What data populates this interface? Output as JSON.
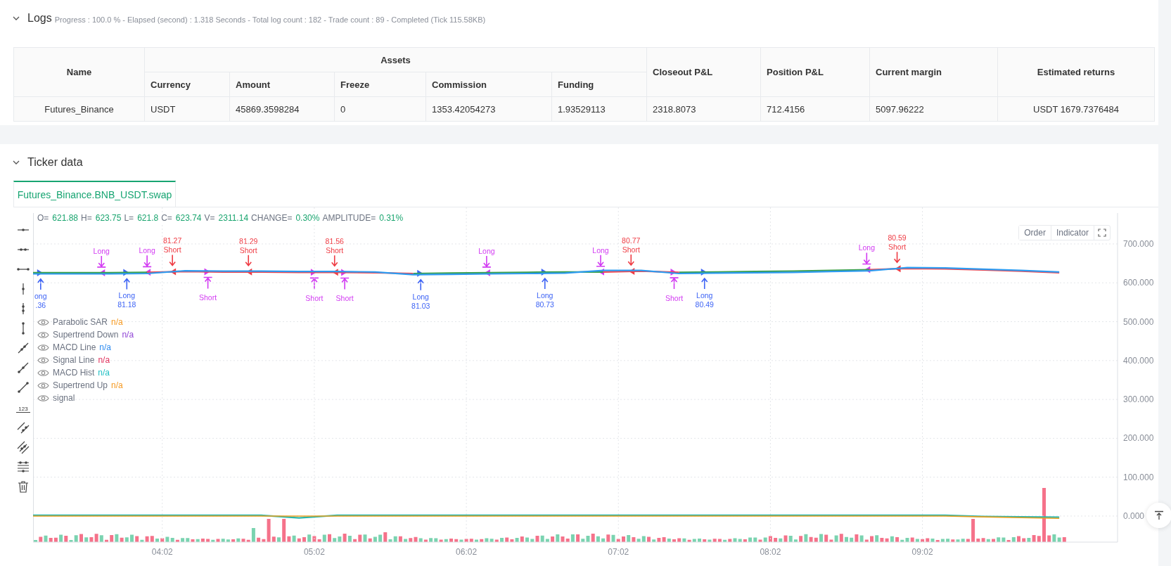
{
  "logs": {
    "title": "Logs",
    "expanded": true,
    "summary": "Progress : 100.0 % - Elapsed (second) : 1.318  Seconds - Total log count : 182 - Trade count : 89 - Completed (Tick 115.58KB)",
    "table": {
      "header_rows": [
        [
          {
            "text": "Name",
            "rowspan": 2
          },
          {
            "text": "Assets",
            "colspan": 5
          },
          {
            "text": "Closeout P&L",
            "rowspan": 2
          },
          {
            "text": "Position P&L",
            "rowspan": 2
          },
          {
            "text": "Current margin",
            "rowspan": 2
          },
          {
            "text": "Estimated returns",
            "rowspan": 2
          }
        ],
        [
          {
            "text": "Currency"
          },
          {
            "text": "Amount"
          },
          {
            "text": "Freeze"
          },
          {
            "text": "Commission"
          },
          {
            "text": "Funding"
          }
        ]
      ],
      "rows": [
        [
          "Futures_Binance",
          "USDT",
          "45869.3598284",
          "0",
          "1353.42054273",
          "1.93529113",
          "2318.8073",
          "712.4156",
          "5097.96222",
          "USDT 1679.7376484"
        ]
      ]
    }
  },
  "ticker": {
    "title": "Ticker data",
    "expanded": true,
    "tabs": [
      {
        "label": "Futures_Binance.BNB_USDT.swap",
        "selected": true
      }
    ],
    "chart": {
      "drawing_tools": [
        {
          "kind": "h-dot"
        },
        {
          "kind": "h-two-dots"
        },
        {
          "kind": "h-segment"
        },
        {
          "kind": "v-dot"
        },
        {
          "kind": "v-two-dots"
        },
        {
          "kind": "v-segment"
        },
        {
          "kind": "ray-two-dots"
        },
        {
          "kind": "ray-dot"
        },
        {
          "kind": "segment"
        },
        {
          "kind": "price-note",
          "text": "123"
        },
        {
          "kind": "parallel"
        },
        {
          "kind": "channel"
        },
        {
          "kind": "fib"
        },
        {
          "kind": "trash"
        }
      ],
      "ohlc": [
        {
          "label": "O=",
          "value": "621.88"
        },
        {
          "label": "H=",
          "value": "623.75"
        },
        {
          "label": "L=",
          "value": "621.8"
        },
        {
          "label": "C=",
          "value": "623.74"
        },
        {
          "label": "V=",
          "value": "2311.14"
        },
        {
          "label": "CHANGE=",
          "value": "0.30%"
        },
        {
          "label": "AMPLITUDE=",
          "value": "0.31%"
        }
      ],
      "legend": [
        {
          "name": "Parabolic SAR",
          "value": "n/a",
          "color": "#f59a23"
        },
        {
          "name": "Supertrend Down",
          "value": "n/a",
          "color": "#9247d6"
        },
        {
          "name": "MACD Line",
          "value": "n/a",
          "color": "#2f8cf0"
        },
        {
          "name": "Signal Line",
          "value": "n/a",
          "color": "#e0335e"
        },
        {
          "name": "MACD Hist",
          "value": "n/a",
          "color": "#1fbfc4"
        },
        {
          "name": "Supertrend Up",
          "value": "n/a",
          "color": "#f59a23"
        },
        {
          "name": "signal"
        }
      ],
      "buttons": [
        "Order",
        "Indicator"
      ],
      "signals": [
        {
          "kind": "long-entry",
          "label": "ong",
          "value": ".36"
        },
        {
          "kind": "long-exit",
          "label": "Long"
        },
        {
          "kind": "long-entry",
          "label": "Long",
          "value": "81.18"
        },
        {
          "kind": "long-exit",
          "label": "Long"
        },
        {
          "kind": "short-entry",
          "label": "Short",
          "value": "81.27"
        },
        {
          "kind": "short-exit",
          "label": "Short"
        },
        {
          "kind": "short-entry",
          "label": "Short",
          "value": "81.29"
        },
        {
          "kind": "short-exit",
          "label": "Short"
        },
        {
          "kind": "short-entry",
          "label": "Short",
          "value": "81.56"
        },
        {
          "kind": "short-exit",
          "label": "Short"
        },
        {
          "kind": "long-entry",
          "label": "Long",
          "value": "81.03"
        },
        {
          "kind": "long-exit",
          "label": "Long"
        },
        {
          "kind": "long-entry",
          "label": "Long",
          "value": "80.73"
        },
        {
          "kind": "long-exit",
          "label": "Long"
        },
        {
          "kind": "short-entry",
          "label": "Short",
          "value": "80.77"
        },
        {
          "kind": "short-exit",
          "label": "Short"
        },
        {
          "kind": "long-entry",
          "label": "Long",
          "value": "80.49"
        },
        {
          "kind": "long-exit",
          "label": "Long"
        },
        {
          "kind": "short-entry",
          "label": "Short",
          "value": "80.59"
        }
      ],
      "chart_data": {
        "type": "line",
        "grid": true,
        "x": [
          191,
          206,
          221,
          236,
          251,
          266,
          281,
          296,
          311,
          326,
          341,
          356,
          371,
          386,
          401,
          416,
          431,
          446,
          461,
          476,
          491,
          506,
          521,
          536,
          551,
          566,
          581,
          596
        ],
        "series": [
          {
            "color": "#3aa04a",
            "values": [
              626,
              626,
              626,
              627,
              null,
              null,
              null,
              null,
              null,
              null,
              624,
              625,
              626,
              627,
              628,
              628,
              null,
              627,
              628,
              629,
              630,
              632,
              634,
              null,
              null,
              null,
              null,
              null
            ]
          },
          {
            "color": "#f0464e",
            "values": [
              null,
              null,
              null,
              627,
              629,
              628,
              628,
              627,
              627,
              626,
              624,
              null,
              null,
              null,
              null,
              628,
              630,
              627,
              null,
              null,
              null,
              null,
              634,
              637,
              636,
              633,
              630,
              626
            ]
          },
          {
            "color": "#2e9bf0",
            "values": [
              623,
              623,
              623,
              624,
              631,
              630,
              630,
              629,
              629,
              628,
              621,
              622,
              623,
              624,
              625,
              632,
              632,
              624,
              625,
              626,
              627,
              629,
              631,
              639,
              638,
              635,
              632,
              628
            ]
          },
          {
            "color": "#2bb5a8",
            "values": [
              2,
              2,
              2,
              2,
              2,
              2,
              2,
              -5,
              2,
              2,
              2,
              2,
              2,
              2,
              2,
              2,
              2,
              2,
              2,
              2,
              2,
              2,
              2,
              2,
              2,
              -1,
              -2,
              -3
            ]
          },
          {
            "color": "#e8a020",
            "values": [
              0,
              0,
              0,
              0,
              0,
              0,
              0,
              0,
              0,
              0,
              0,
              0,
              0,
              0,
              0,
              0,
              0,
              0,
              0,
              0,
              0,
              0,
              0,
              0,
              0,
              -2,
              -4,
              -6
            ]
          }
        ],
        "xlim": [
          191,
          619
        ],
        "ylim": [
          -67,
          794
        ],
        "xticks": [
          {
            "value": 242,
            "label": "04:02"
          },
          {
            "value": 302,
            "label": "05:02"
          },
          {
            "value": 362,
            "label": "06:02"
          },
          {
            "value": 422,
            "label": "07:02"
          },
          {
            "value": 482,
            "label": "08:02"
          },
          {
            "value": 542,
            "label": "09:02"
          }
        ],
        "yticks": [
          {
            "value": 0,
            "label": "0.000"
          },
          {
            "value": 100,
            "label": "100.000"
          },
          {
            "value": 200,
            "label": "200.000"
          },
          {
            "value": 300,
            "label": "300.000"
          },
          {
            "value": 400,
            "label": "400.000"
          },
          {
            "value": 500,
            "label": "500.000"
          },
          {
            "value": 600,
            "label": "600.000"
          },
          {
            "value": 700,
            "label": "700.000"
          }
        ]
      }
    }
  }
}
